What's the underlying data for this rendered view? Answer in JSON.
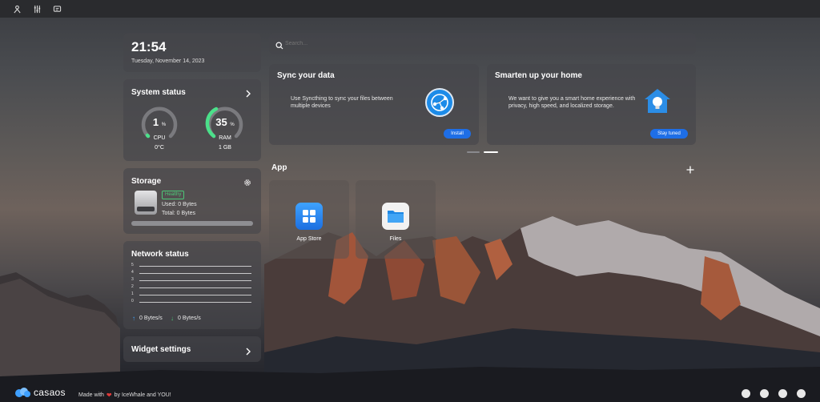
{
  "topbar": {
    "icons": [
      "user-icon",
      "sliders-icon",
      "chat-icon"
    ]
  },
  "clock": {
    "time": "21:54",
    "date": "Tuesday, November 14, 2023"
  },
  "system_status": {
    "title": "System status",
    "cpu": {
      "value": "1",
      "unit": "%",
      "label": "CPU",
      "sub": "0°C",
      "fraction": 0.01
    },
    "ram": {
      "value": "35",
      "unit": "%",
      "label": "RAM",
      "sub": "1 GB",
      "fraction": 0.35
    }
  },
  "storage": {
    "title": "Storage",
    "badge": "Healthy",
    "used": "Used: 0 Bytes",
    "total": "Total: 0 Bytes",
    "fraction": 0
  },
  "network": {
    "title": "Network status",
    "ticks": [
      "5",
      "4",
      "3",
      "2",
      "1",
      "0"
    ],
    "up": "0 Bytes/s",
    "down": "0 Bytes/s"
  },
  "widget_settings": {
    "label": "Widget settings"
  },
  "search": {
    "placeholder": "Search..."
  },
  "promo_sync": {
    "title": "Sync your data",
    "text": "Use Syncthing to sync your files between multiple devices",
    "button": "Install"
  },
  "promo_home": {
    "title": "Smarten up your home",
    "text": "We want to give you a smart home experience with privacy, high speed, and localized storage.",
    "button": "Stay tuned"
  },
  "apps_section": {
    "title": "App"
  },
  "apps": [
    {
      "name": "App Store",
      "icon": "app-store-icon"
    },
    {
      "name": "Files",
      "icon": "files-folder-icon"
    }
  ],
  "footer": {
    "logo": "casaos",
    "made_with": "Made with",
    "by": "by IceWhale and YOU!",
    "social_icons": [
      "forum-icon",
      "discord-icon",
      "github-icon",
      "feedback-icon"
    ]
  },
  "colors": {
    "accent": "#1e6ee6",
    "gauge_green": "#4be08a",
    "healthy": "#4cc777",
    "heart": "#e23a3a"
  }
}
